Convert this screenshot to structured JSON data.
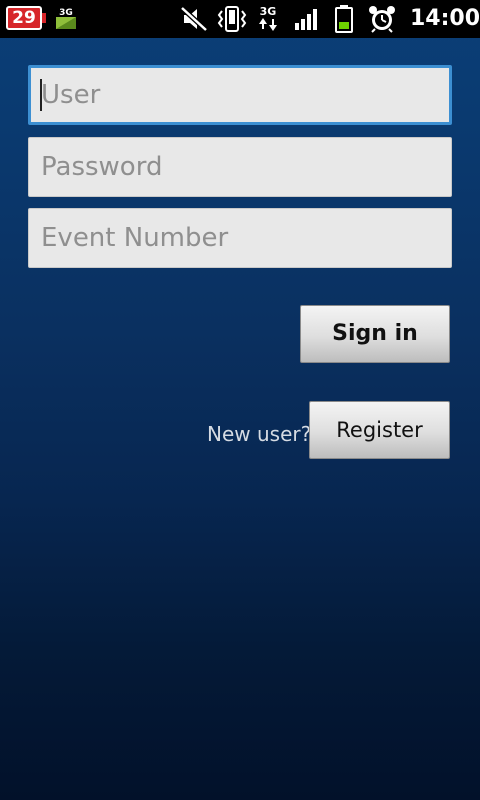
{
  "status_bar": {
    "notification_count": "29",
    "data_badge": "3G",
    "network_type": "3G",
    "time": "14:00",
    "icons": [
      "calendar-badge-icon",
      "3g-data-icon",
      "mute-icon",
      "vibrate-icon",
      "3g-network-icon",
      "signal-icon",
      "battery-icon",
      "alarm-icon"
    ],
    "battery_color": "#6fd400"
  },
  "form": {
    "user_placeholder": "User",
    "user_value": "",
    "password_placeholder": "Password",
    "password_value": "",
    "event_number_placeholder": "Event Number",
    "event_number_value": "",
    "sign_in_label": "Sign in",
    "new_user_label": "New user?",
    "register_label": "Register"
  },
  "colors": {
    "focus_border": "#3c8fd2",
    "background_top": "#0b3f78",
    "background_bottom": "#02112a"
  }
}
